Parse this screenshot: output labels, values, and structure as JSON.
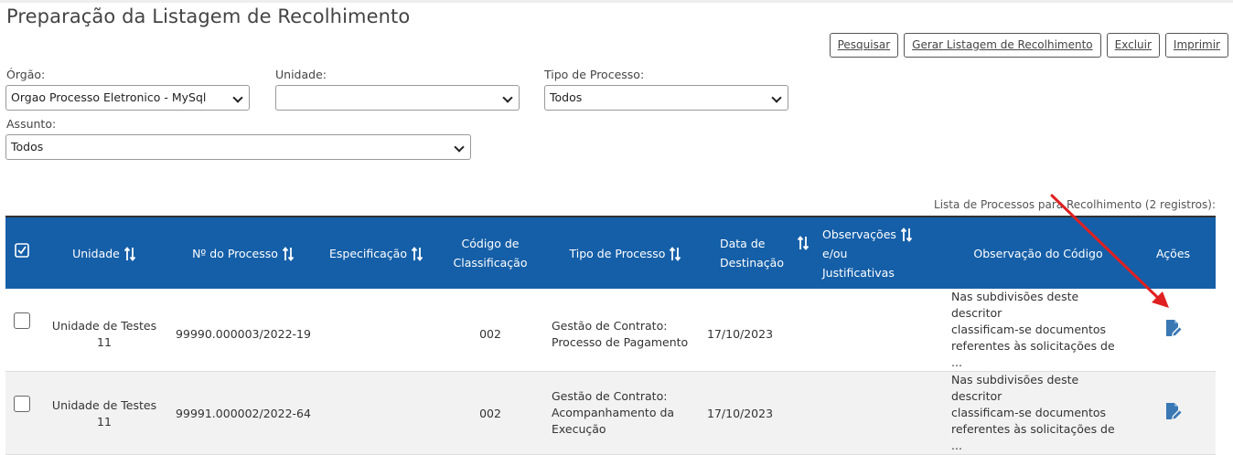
{
  "page": {
    "title": "Preparação da Listagem de Recolhimento"
  },
  "toolbar": {
    "search_label": "Pesquisar",
    "generate_label": "Gerar Listagem de Recolhimento",
    "delete_label": "Excluir",
    "print_label": "Imprimir"
  },
  "filters": {
    "orgao": {
      "label": "Órgão:",
      "value": "Orgao Processo Eletronico - MySql"
    },
    "unidade": {
      "label": "Unidade:",
      "value": ""
    },
    "tipo_processo": {
      "label": "Tipo de Processo:",
      "value": "Todos"
    },
    "assunto": {
      "label": "Assunto:",
      "value": "Todos"
    }
  },
  "table": {
    "caption": "Lista de Processos para Recolhimento (2 registros):",
    "header_color": "#155fa8",
    "columns": {
      "unidade": "Unidade",
      "numero": "Nº do Processo",
      "especificacao": "Especificação",
      "codigo_l1": "Código de",
      "codigo_l2": "Classificação",
      "tipo": "Tipo de Processo",
      "data_l1": "Data de",
      "data_l2": "Destinação",
      "obs_l1": "Observações",
      "obs_l2": "e/ou",
      "obs_l3": "Justificativas",
      "obs_codigo": "Observação do Código",
      "acoes": "Ações"
    },
    "rows": [
      {
        "unidade": "Unidade de Testes 11",
        "numero": "99990.000003/2022-19",
        "especificacao": "",
        "codigo": "002",
        "tipo_l1": "Gestão de Contrato:",
        "tipo_l2": "Processo de Pagamento",
        "tipo_l3": "",
        "data": "17/10/2023",
        "observacoes": "",
        "obs_codigo_l1": "Nas subdivisões deste descritor",
        "obs_codigo_l2": "classificam-se documentos",
        "obs_codigo_l3": "referentes às solicitações de ..."
      },
      {
        "unidade": "Unidade de Testes 11",
        "numero": "99991.000002/2022-64",
        "especificacao": "",
        "codigo": "002",
        "tipo_l1": "Gestão de Contrato:",
        "tipo_l2": "Acompanhamento da",
        "tipo_l3": "Execução",
        "data": "17/10/2023",
        "observacoes": "",
        "obs_codigo_l1": "Nas subdivisões deste descritor",
        "obs_codigo_l2": "classificam-se documentos",
        "obs_codigo_l3": "referentes às solicitações de ..."
      }
    ]
  },
  "icons": {
    "sort": "sort-arrows-icon",
    "edit": "edit-document-icon",
    "select_all": "checkbox-check-icon",
    "annotation": "red-arrow-icon"
  },
  "colors": {
    "icon_blue": "#3a78b5",
    "annotation_red": "#e02020"
  }
}
